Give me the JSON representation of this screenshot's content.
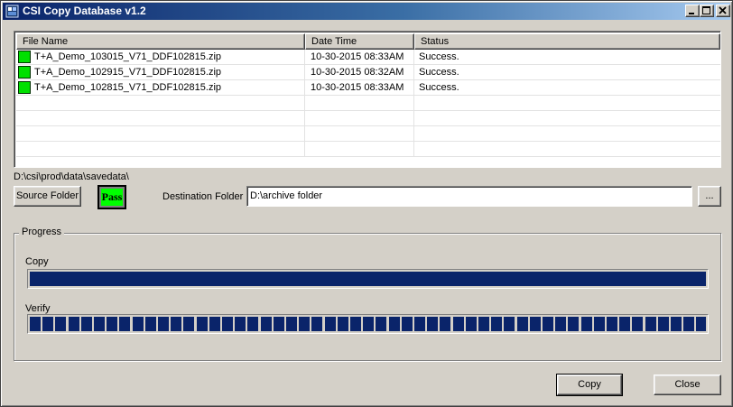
{
  "window": {
    "title": "CSI Copy Database v1.2"
  },
  "file_list": {
    "columns": [
      "File Name",
      "Date Time",
      "Status"
    ],
    "rows": [
      {
        "file": "T+A_Demo_103015_V71_DDF102815.zip",
        "datetime": "10-30-2015 08:33AM",
        "status": "Success."
      },
      {
        "file": "T+A_Demo_102915_V71_DDF102815.zip",
        "datetime": "10-30-2015 08:32AM",
        "status": "Success."
      },
      {
        "file": "T+A_Demo_102815_V71_DDF102815.zip",
        "datetime": "10-30-2015 08:33AM",
        "status": "Success."
      }
    ]
  },
  "source": {
    "path": "D:\\csi\\prod\\data\\savedata\\",
    "button_label": "Source Folder",
    "result_badge": "Pass"
  },
  "destination": {
    "label": "Destination Folder :",
    "value": "D:\\archive folder",
    "browse_label": "..."
  },
  "progress": {
    "group_title": "Progress",
    "copy_label": "Copy",
    "copy_percent": 100,
    "verify_label": "Verify",
    "verify_percent": 100
  },
  "actions": {
    "copy_label": "Copy",
    "close_label": "Close"
  },
  "colors": {
    "success_icon": "#00e000",
    "pass_badge": "#00ff00",
    "progress_fill": "#0a246a"
  },
  "icons": [
    "app-icon",
    "minimize-icon",
    "maximize-icon",
    "close-icon",
    "success-icon"
  ]
}
